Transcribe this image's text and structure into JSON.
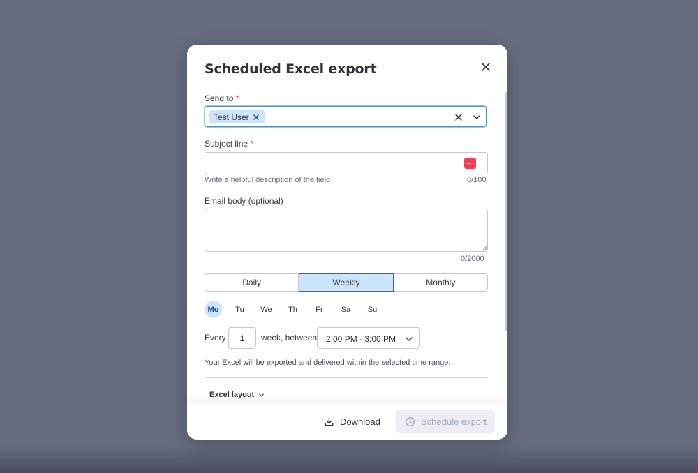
{
  "modal": {
    "title": "Scheduled Excel export",
    "close_icon": "close-icon"
  },
  "send_to": {
    "label": "Send to",
    "required_mark": "*",
    "chips": [
      {
        "label": "Test User"
      }
    ],
    "icons": {
      "remove": "x-icon",
      "clear": "close-icon",
      "dropdown": "chevron-down-icon"
    }
  },
  "subject": {
    "label": "Subject line",
    "required_mark": "*",
    "value": "",
    "helper": "Write a helpful description of the field",
    "counter": "0/100",
    "icon": "dots-icon"
  },
  "email_body": {
    "label": "Email body (optional)",
    "value": "",
    "counter": "0/2000"
  },
  "frequency": {
    "options": [
      "Daily",
      "Weekly",
      "Monthly"
    ],
    "selected": "Weekly"
  },
  "days": {
    "items": [
      "Mo",
      "Tu",
      "We",
      "Th",
      "Fr",
      "Sa",
      "Su"
    ],
    "selected": [
      "Mo"
    ]
  },
  "schedule": {
    "every_label": "Every",
    "interval_value": "1",
    "unit_label": "week, between",
    "time_range": "2:00 PM - 3:00 PM"
  },
  "note": "Your Excel will be exported and delivered within the selected time range.",
  "excel_layout": {
    "label": "Excel layout"
  },
  "footer": {
    "download_label": "Download",
    "schedule_label": "Schedule export",
    "schedule_disabled": true
  },
  "colors": {
    "backdrop": "#676c80",
    "accent": "#0073ea",
    "selected_bg": "#cce5ff",
    "required": "#d83a52",
    "disabled_text": "#a4a8bd"
  }
}
